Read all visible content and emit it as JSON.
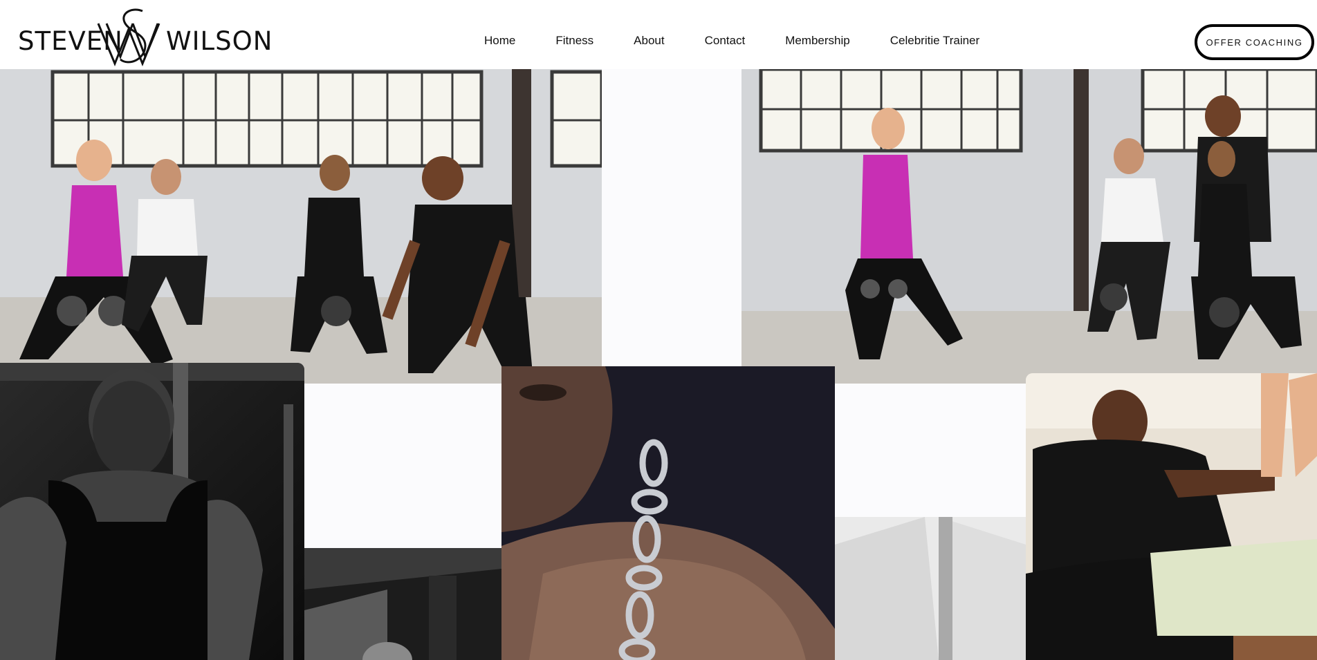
{
  "brand": {
    "first": "STEVEN",
    "last": "WILSON",
    "monogram": "SW"
  },
  "nav": {
    "items": [
      {
        "label": "Home"
      },
      {
        "label": "Fitness"
      },
      {
        "label": "About"
      },
      {
        "label": "Contact"
      },
      {
        "label": "Membership"
      },
      {
        "label": "Celebritie Trainer"
      }
    ]
  },
  "cta": {
    "label": "OFFER COACHING"
  },
  "colors": {
    "text": "#111111",
    "background": "#ffffff",
    "accent_magenta": "#c82fb4",
    "dark_panel": "#1b1a26"
  },
  "gallery": {
    "tiles": [
      {
        "name": "group-kettlebell-squat-photo",
        "icon": "photo"
      },
      {
        "name": "group-lunge-coaching-photo",
        "icon": "photo"
      },
      {
        "name": "trainer-portrait-tank-photo",
        "icon": "photo"
      },
      {
        "name": "chain-shoulder-photo",
        "icon": "photo"
      },
      {
        "name": "gym-equipment-photo",
        "icon": "photo"
      },
      {
        "name": "abstract-light-photo",
        "icon": "photo"
      },
      {
        "name": "trainer-stretch-assist-photo",
        "icon": "photo"
      }
    ]
  }
}
